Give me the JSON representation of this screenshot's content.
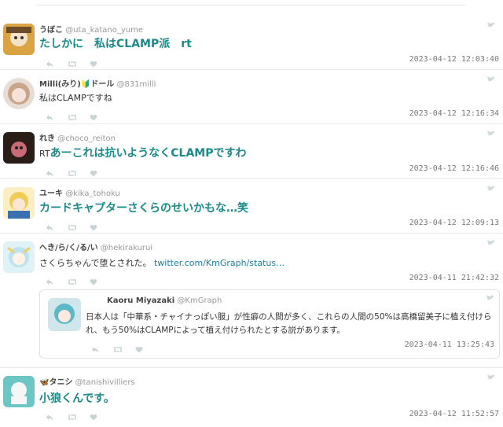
{
  "tweets": [
    {
      "name": "うぼこ",
      "handle": "@uta_katano_yume",
      "text": "たしかに　私はCLAMP派　rt",
      "style": "big",
      "time": "2023-04-12 12:03:40"
    },
    {
      "name": "Milli(みり)🔰ドール",
      "handle": "@831milli",
      "text": "私はCLAMPですね",
      "style": "small",
      "time": "2023-04-12 12:16:34"
    },
    {
      "name": "れき",
      "handle": "@choco_reiton",
      "text_prefix": "RT",
      "text": "あーこれは抗いようなくCLAMPですわ",
      "style": "big",
      "time": "2023-04-12 12:16:46"
    },
    {
      "name": "ユーキ",
      "handle": "@kika_tohoku",
      "text": "カードキャプターさくらのせいかもな…笑",
      "style": "big",
      "time": "2023-04-12 12:09:13"
    },
    {
      "name": "へき/ら/く/る/い",
      "handle": "@hekirakurui",
      "text": "さくらちゃんで堕とされた。",
      "link": "twitter.com/KmGraph/status…",
      "style": "small",
      "time": "2023-04-11 21:42:32"
    },
    {
      "name": "🦋タニシ",
      "handle": "@tanishivilliers",
      "text": "小狼くんです。",
      "style": "big",
      "time": "2023-04-12 11:52:57"
    }
  ],
  "quote": {
    "name": "Kaoru Miyazaki",
    "handle": "@KmGraph",
    "text": "日本人は「中華系・チャイナっぽい服」が性癖の人間が多く、これらの人間の50%は高橋留美子に植え付けられ、もう50%はCLAMPによって植え付けられたとする説があります。",
    "time": "2023-04-11 13:25:43"
  },
  "icons": {
    "reply": "reply-icon",
    "retweet": "retweet-icon",
    "like": "heart-icon",
    "brand": "bird-icon"
  },
  "colors": {
    "accent_text": "#1a8a8a",
    "link": "#1a7ea8",
    "icon": "#c8d3d6"
  }
}
